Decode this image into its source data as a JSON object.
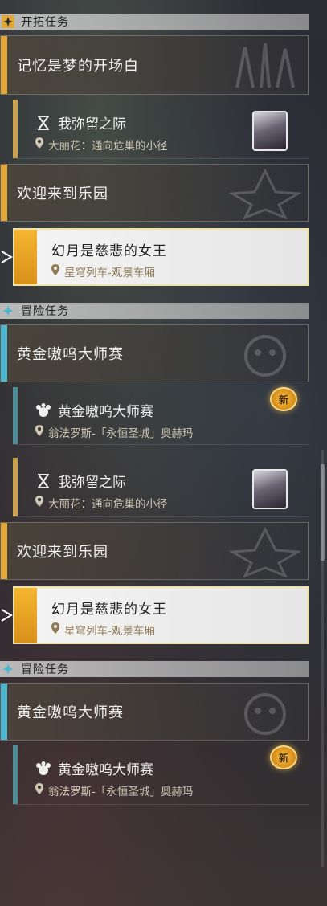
{
  "sections": {
    "trailblaze": {
      "label": "开拓任务"
    },
    "adventure": {
      "label": "冒险任务"
    }
  },
  "chapters": {
    "memory": "记忆是梦的开场白",
    "welcome": "欢迎来到乐园",
    "golden_hour": "黄金嗷呜大师赛"
  },
  "quests": {
    "while_i_remain": {
      "title": "我弥留之际",
      "location": "大丽花：通向危巢的小径"
    },
    "moon_queen": {
      "title": "幻月是慈悲的女王",
      "location": "星穹列车-观景车厢"
    },
    "golden_awoo": {
      "title": "黄金嗷呜大师赛",
      "location": "翁法罗斯-「永恒圣城」奥赫玛"
    }
  },
  "badge": {
    "new": "新"
  },
  "colors": {
    "trailblaze_accent": "#e2a93a",
    "adventure_accent": "#4fb6d0",
    "selected_gold": "#f5b631",
    "new_badge": "#f6c347"
  },
  "icons": {
    "section_trailblaze": "trailblaze-star-icon",
    "section_adventure": "adventure-star-icon",
    "quest_type_trailblaze": "hourglass-icon",
    "quest_type_adventure": "paw-icon",
    "location": "location-pin-icon"
  }
}
